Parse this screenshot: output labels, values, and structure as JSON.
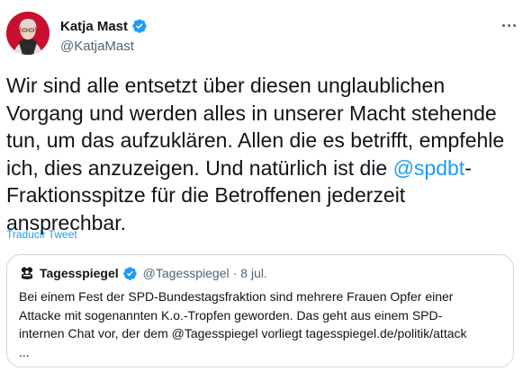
{
  "author": {
    "name": "Katja Mast",
    "handle": "@KatjaMast"
  },
  "tweet": {
    "lines": [
      "Wir sind alle entsetzt über diesen unglaublichen",
      "Vorgang und werden alles in unserer Macht stehende",
      "tun, um das aufzuklären. Allen die es betrifft, empfehle",
      "ich, dies anzuzeigen. Und natürlich ist die "
    ],
    "mention": "@spdbt",
    "line4_tail": "-",
    "lines_after": [
      "Fraktionsspitze für die Betroffenen jederzeit",
      "ansprechbar."
    ]
  },
  "translate_label": "Traducir Tweet",
  "quote": {
    "name": "Tagesspiegel",
    "handle": "@Tagesspiegel",
    "separator": "·",
    "date": "8 jul.",
    "lines": [
      "Bei einem Fest der SPD-Bundestagsfraktion sind mehrere Frauen Opfer einer",
      "Attacke mit sogenannten K.o.-Tropfen geworden. Das geht aus einem SPD-",
      "internen Chat vor, der dem @Tagesspiegel vorliegt tagesspiegel.de/politik/attack",
      "..."
    ]
  },
  "colors": {
    "link": "#1d9bf0",
    "text": "#0f1419",
    "secondary": "#536471",
    "border": "#cfd9de"
  },
  "icons": {
    "more": "more-horizontal-icon",
    "verified": "verified-badge-icon"
  }
}
